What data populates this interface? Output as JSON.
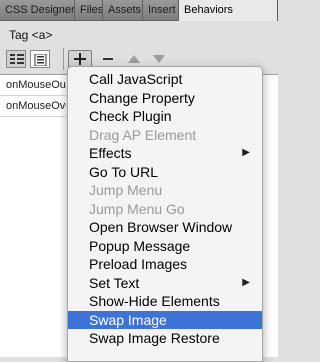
{
  "tabs": [
    "CSS Designer",
    "Files",
    "Assets",
    "Insert",
    "Behaviors"
  ],
  "active_tab": "Behaviors",
  "tag_label": "Tag <a>",
  "events": [
    "onMouseOut",
    "onMouseOver"
  ],
  "menu_items": [
    {
      "label": "Call JavaScript",
      "enabled": true
    },
    {
      "label": "Change Property",
      "enabled": true
    },
    {
      "label": "Check Plugin",
      "enabled": true
    },
    {
      "label": "Drag AP Element",
      "enabled": false
    },
    {
      "label": "Effects",
      "enabled": true,
      "submenu": true
    },
    {
      "label": "Go To URL",
      "enabled": true
    },
    {
      "label": "Jump Menu",
      "enabled": false
    },
    {
      "label": "Jump Menu Go",
      "enabled": false
    },
    {
      "label": "Open Browser Window",
      "enabled": true
    },
    {
      "label": "Popup Message",
      "enabled": true
    },
    {
      "label": "Preload Images",
      "enabled": true
    },
    {
      "label": "Set Text",
      "enabled": true,
      "submenu": true
    },
    {
      "label": "Show-Hide Elements",
      "enabled": true
    },
    {
      "label": "Swap Image",
      "enabled": true,
      "selected": true
    },
    {
      "label": "Swap Image Restore",
      "enabled": true
    }
  ],
  "icons": {
    "show_set_events": "list-view-icon",
    "show_all_events": "all-events-icon",
    "add": "plus-icon",
    "remove": "minus-icon",
    "move_up": "up-arrow-icon",
    "move_down": "down-arrow-icon",
    "submenu": "chevron-right-icon"
  },
  "colors": {
    "selection": "#3d73d6",
    "disabled_text": "#9a9a9a"
  }
}
